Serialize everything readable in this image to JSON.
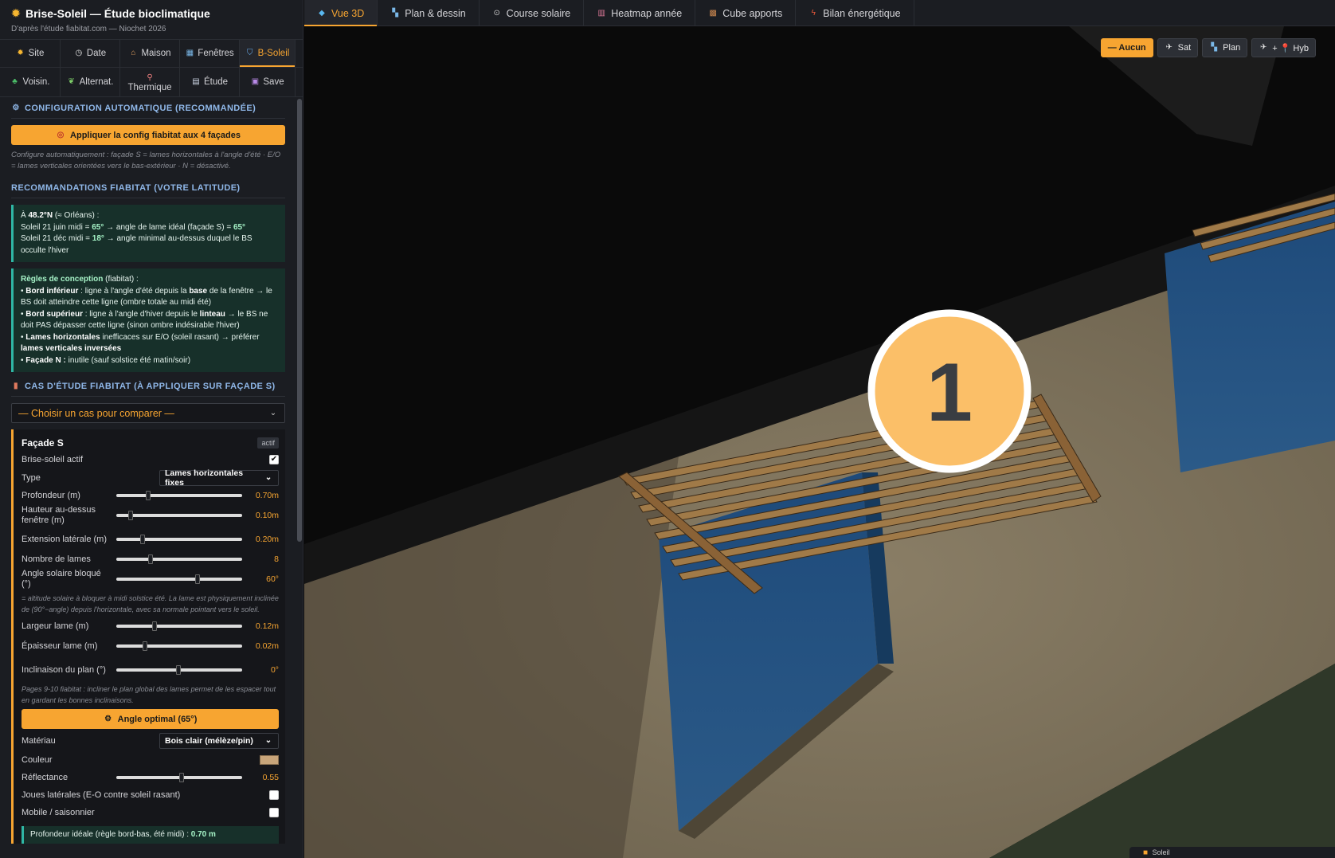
{
  "app": {
    "title": "Brise-Soleil — Étude bioclimatique",
    "subtitle": "D'après l'étude fiabitat.com — Niochet 2026"
  },
  "nav_row1": [
    {
      "label": "Site",
      "icon": "sun-icon"
    },
    {
      "label": "Date",
      "icon": "clock-icon"
    },
    {
      "label": "Maison",
      "icon": "house-icon"
    },
    {
      "label": "Fenêtres",
      "icon": "window-icon"
    },
    {
      "label": "B-Soleil",
      "icon": "shield-icon"
    }
  ],
  "nav_row2": [
    {
      "label": "Voisin.",
      "icon": "tree-icon"
    },
    {
      "label": "Alternat.",
      "icon": "leaf-icon"
    },
    {
      "label": "Thermique",
      "icon": "thermometer-icon"
    },
    {
      "label": "Étude",
      "icon": "book-icon"
    },
    {
      "label": "Save",
      "icon": "floppy-icon"
    }
  ],
  "auto_config": {
    "heading": "CONFIGURATION AUTOMATIQUE (RECOMMANDÉE)",
    "button": "Appliquer la config fiabitat aux 4 façades",
    "note": "Configure automatiquement : façade S = lames horizontales à l'angle d'été · E/O = lames verticales orientées vers le bas-extérieur · N = désactivé."
  },
  "recommendations": {
    "heading": "RECOMMANDATIONS FIABITAT (VOTRE LATITUDE)",
    "box1": {
      "l1a": "À ",
      "l1b": "48.2°N",
      "l1c": " (≈ Orléans) :",
      "l2a": "Soleil 21 juin midi = ",
      "l2b": "65°",
      "l2c": " → angle de lame idéal (façade S) = ",
      "l2d": "65°",
      "l3a": "Soleil 21 déc midi = ",
      "l3b": "18°",
      "l3c": " → angle minimal au-dessus duquel le BS occulte l'hiver"
    },
    "box2": {
      "t1": "Règles de conception",
      "t2": " (fiabitat) :",
      "b1a": "• ",
      "b1b": "Bord inférieur",
      "b1c": " : ligne à l'angle d'été depuis la ",
      "b1d": "base",
      "b1e": " de la fenêtre → le BS doit atteindre cette ligne (ombre totale au midi été)",
      "b2a": "• ",
      "b2b": "Bord supérieur",
      "b2c": " : ligne à l'angle d'hiver depuis le ",
      "b2d": "linteau",
      "b2e": " → le BS ne doit PAS dépasser cette ligne (sinon ombre indésirable l'hiver)",
      "b3a": "• ",
      "b3b": "Lames horizontales",
      "b3c": " inefficaces sur E/O (soleil rasant) → préférer ",
      "b3d": "lames verticales inversées",
      "b4a": "• ",
      "b4b": "Façade N :",
      "b4c": " inutile (sauf solstice été matin/soir)"
    }
  },
  "case_study": {
    "heading": "CAS D'ÉTUDE FIABITAT (À APPLIQUER SUR FAÇADE S)",
    "select": "— Choisir un cas pour comparer —"
  },
  "facade": {
    "title": "Façade S",
    "badge": "actif",
    "active_label": "Brise-soleil actif",
    "type_label": "Type",
    "type_value": "Lames horizontales fixes",
    "sliders1": [
      {
        "label": "Profondeur (m)",
        "value": "0.70m",
        "pos": 0.25
      },
      {
        "label": "Hauteur au-dessus fenêtre (m)",
        "value": "0.10m",
        "pos": 0.1
      },
      {
        "label": "Extension latérale (m)",
        "value": "0.20m",
        "pos": 0.2
      },
      {
        "label": "Nombre de lames",
        "value": "8",
        "pos": 0.27
      },
      {
        "label": "Angle solaire bloqué (°)",
        "value": "60°",
        "pos": 0.66
      }
    ],
    "angle_note": "= altitude solaire à bloquer à midi solstice été. La lame est physiquement inclinée de (90°−angle) depuis l'horizontale, avec sa normale pointant vers le soleil.",
    "sliders2": [
      {
        "label": "Largeur lame (m)",
        "value": "0.12m",
        "pos": 0.3
      },
      {
        "label": "Épaisseur lame (m)",
        "value": "0.02m",
        "pos": 0.22
      },
      {
        "label": "Inclinaison du plan (°)",
        "value": "0°",
        "pos": 0.5
      }
    ],
    "plane_note": "Pages 9-10 fiabitat : incliner le plan global des lames permet de les espacer tout en gardant les bonnes inclinaisons.",
    "optimal_button": "Angle optimal (65°)",
    "material_label": "Matériau",
    "material_value": "Bois clair (mélèze/pin)",
    "color_label": "Couleur",
    "color_hex": "#c8a57a",
    "reflectance_label": "Réflectance",
    "reflectance_value": "0.55",
    "reflectance_pos": 0.53,
    "joues_label": "Joues latérales (E-O contre soleil rasant)",
    "mobile_label": "Mobile / saisonnier",
    "ideal_a": "Profondeur idéale (règle bord-bas, été midi) : ",
    "ideal_b": "0.70 m"
  },
  "tabs": [
    {
      "label": "Vue 3D",
      "icon": "cube-icon"
    },
    {
      "label": "Plan & dessin",
      "icon": "map-icon"
    },
    {
      "label": "Course solaire",
      "icon": "sun-path-icon"
    },
    {
      "label": "Heatmap année",
      "icon": "bar-chart-icon"
    },
    {
      "label": "Cube apports",
      "icon": "box-icon"
    },
    {
      "label": "Bilan énergétique",
      "icon": "bolt-icon"
    }
  ],
  "map_layers": [
    {
      "label": "— Aucun",
      "icon": ""
    },
    {
      "label": "Sat",
      "icon": "satellite-icon"
    },
    {
      "label": "Plan",
      "icon": "map-icon"
    },
    {
      "label": "+ 📍 Hyb",
      "icon": "satellite-icon"
    }
  ],
  "scene": {
    "marker_number": "1",
    "corner_label": "Soleil"
  },
  "colors": {
    "accent": "#f7a531",
    "panel_bg": "#1b1d22",
    "wall": "#7c705a",
    "glass": "#24507e",
    "wood": "#a07a48",
    "ground": "#2f3829"
  }
}
